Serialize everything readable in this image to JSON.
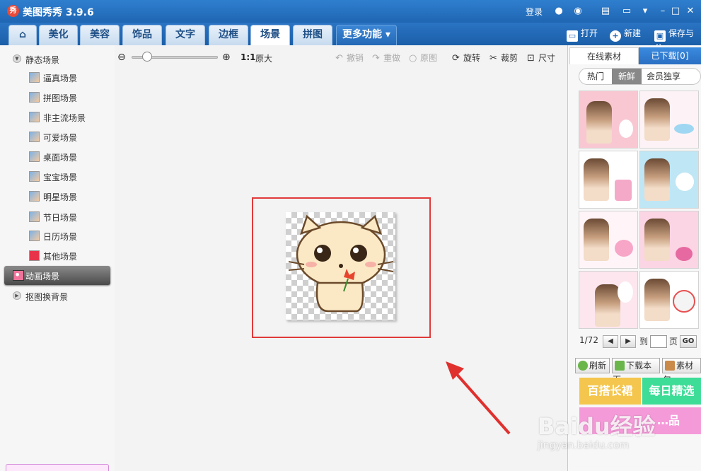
{
  "titlebar": {
    "app_title": "美图秀秀 3.9.6",
    "logo_text": "秀",
    "login_label": "登录"
  },
  "tabs": [
    {
      "label": "美化"
    },
    {
      "label": "美容"
    },
    {
      "label": "饰品"
    },
    {
      "label": "文字"
    },
    {
      "label": "边框"
    },
    {
      "label": "场景",
      "active": true
    },
    {
      "label": "拼图"
    },
    {
      "label": "更多功能"
    }
  ],
  "toolbar": {
    "open_label": "打开",
    "new_label": "新建",
    "save_label": "保存与分"
  },
  "left_panel": {
    "static_group": "静态场景",
    "static_items": [
      "逼真场景",
      "拼图场景",
      "非主流场景",
      "可爱场景",
      "桌面场景",
      "宝宝场景",
      "明星场景",
      "节日场景",
      "日历场景",
      "其他场景"
    ],
    "animation_group": "动画场景",
    "cutout_group": "抠图换背景"
  },
  "canvas_toolbar": {
    "ratio_label": "1:1",
    "original_size_label": "原大",
    "undo_label": "撤销",
    "redo_label": "重做",
    "original_label": "原图",
    "rotate_label": "旋转",
    "crop_label": "裁剪",
    "size_label": "尺寸"
  },
  "right_panel": {
    "tab_online": "在线素材",
    "tab_downloaded": "已下载[0]",
    "filters": [
      "热门",
      "新鲜",
      "会员独享"
    ],
    "active_filter": "新鲜",
    "pager_text": "1/72",
    "goto_label": "到",
    "page_label": "页",
    "go_label": "GO",
    "refresh_label": "刷新",
    "download_page_label": "下载本页",
    "material_label": "素材包",
    "banner1": "百搭长裙",
    "banner2": "每日精选",
    "banner3": "…品"
  },
  "watermark": {
    "brand": "Baidu经验",
    "url": "jingyan.baidu.com"
  },
  "colors": {
    "title_blue": "#1f66b3",
    "frame_red": "#e03a3a",
    "banner_yellow": "#f4c64e",
    "banner_green": "#3ddc97",
    "banner_pink": "#f59ad9"
  }
}
